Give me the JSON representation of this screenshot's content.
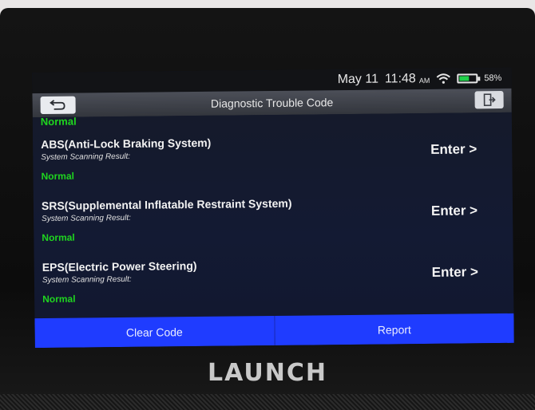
{
  "device": {
    "brand": "LAUNCH"
  },
  "status": {
    "date": "May 11",
    "time": "11:48",
    "ampm": "AM",
    "battery_percent": "58%",
    "battery_level": 0.58,
    "battery_color": "#21d04a",
    "wifi_icon": "wifi-icon",
    "battery_icon": "battery-icon"
  },
  "titlebar": {
    "title": "Diagnostic Trouble Code",
    "back_icon": "back-arrow-icon",
    "exit_icon": "exit-door-icon"
  },
  "list": {
    "partial_status": "Normal",
    "items": [
      {
        "name": "ABS(Anti-Lock Braking System)",
        "sub": "System Scanning Result:",
        "status": "Normal",
        "enter": "Enter >"
      },
      {
        "name": "SRS(Supplemental Inflatable Restraint System)",
        "sub": "System Scanning Result:",
        "status": "Normal",
        "enter": "Enter >"
      },
      {
        "name": "EPS(Electric Power Steering)",
        "sub": "System Scanning Result:",
        "status": "Normal",
        "enter": "Enter >"
      }
    ]
  },
  "actions": {
    "clear_code": "Clear Code",
    "report": "Report",
    "accent": "#1f3cff",
    "status_ok_color": "#1fd51f"
  }
}
